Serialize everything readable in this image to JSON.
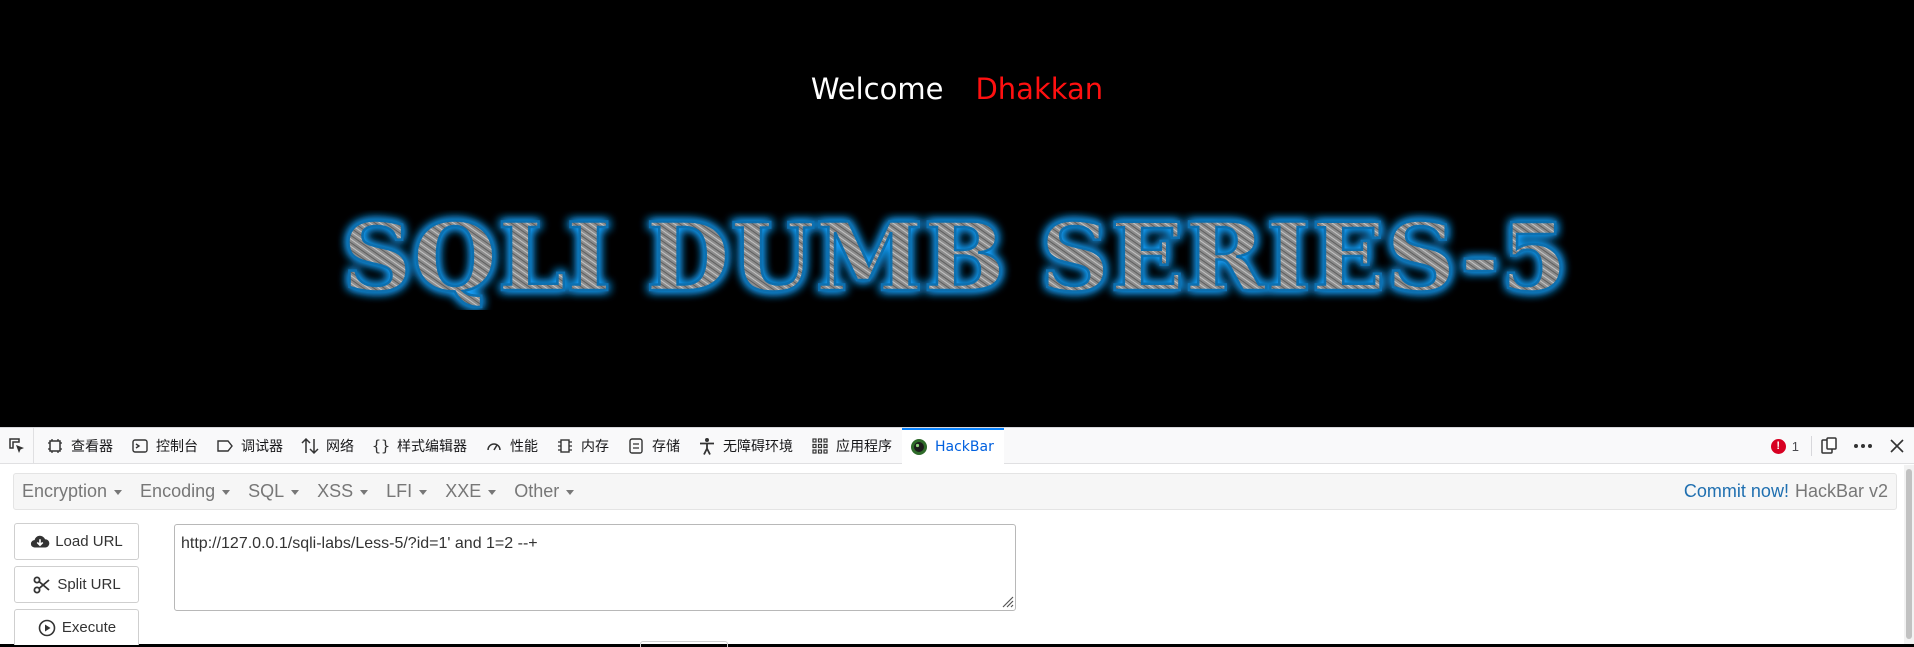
{
  "page": {
    "welcome_text": "Welcome",
    "user_name": "Dhakkan",
    "banner_title": "SQLI DUMB SERIES-5"
  },
  "devtools": {
    "tabs": [
      {
        "label": "查看器",
        "icon": "inspector-icon"
      },
      {
        "label": "控制台",
        "icon": "console-icon"
      },
      {
        "label": "调试器",
        "icon": "debugger-icon"
      },
      {
        "label": "网络",
        "icon": "network-icon"
      },
      {
        "label": "样式编辑器",
        "icon": "style-editor-icon"
      },
      {
        "label": "性能",
        "icon": "performance-icon"
      },
      {
        "label": "内存",
        "icon": "memory-icon"
      },
      {
        "label": "存储",
        "icon": "storage-icon"
      },
      {
        "label": "无障碍环境",
        "icon": "accessibility-icon"
      },
      {
        "label": "应用程序",
        "icon": "application-icon"
      },
      {
        "label": "HackBar",
        "icon": "hackbar-icon",
        "active": true
      }
    ],
    "error_count": "1"
  },
  "hackbar": {
    "menu": [
      "Encryption",
      "Encoding",
      "SQL",
      "XSS",
      "LFI",
      "XXE",
      "Other"
    ],
    "commit_text": "Commit now!",
    "version_text": "HackBar v2",
    "buttons": {
      "load_url": "Load URL",
      "split_url": "Split URL",
      "execute": "Execute"
    },
    "url_value": "http://127.0.0.1/sqli-labs/Less-5/?id=1' and 1=2 --+"
  },
  "colors": {
    "welcome": "#ffffff",
    "user_name": "#ff1010",
    "banner_glow": "#1aa3ff",
    "active_tab": "#0060df",
    "error_badge": "#d70022"
  }
}
